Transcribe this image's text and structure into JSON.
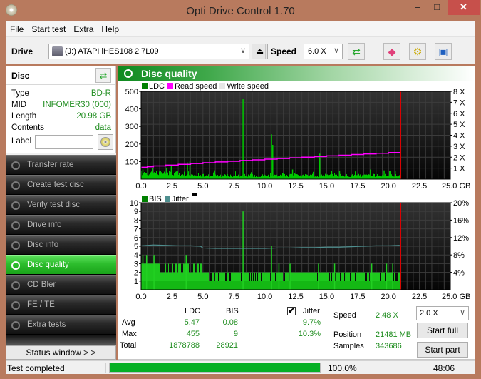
{
  "window": {
    "title": "Opti Drive Control 1.70",
    "min_glyph": "–",
    "max_glyph": "□",
    "close_glyph": "✕"
  },
  "menu": [
    "File",
    "Start test",
    "Extra",
    "Help"
  ],
  "toolbar": {
    "drive_label": "Drive",
    "drive_value": "(J:)   ATAPI iHES108   2 7L09",
    "speed_label": "Speed",
    "speed_value": "6.0 X",
    "eject_glyph": "⏏",
    "refresh_glyph": "⇄",
    "erase_glyph": "◆",
    "settings_glyph": "⚙",
    "save_glyph": "▣",
    "chevron": "∨"
  },
  "disc": {
    "title": "Disc",
    "refresh_glyph": "⇄",
    "rows": [
      {
        "key": "Type",
        "value": "BD-R"
      },
      {
        "key": "MID",
        "value": "INFOMER30 (000)"
      },
      {
        "key": "Length",
        "value": "20.98 GB"
      },
      {
        "key": "Contents",
        "value": "data"
      }
    ],
    "label_key": "Label",
    "label_value": ""
  },
  "nav": [
    {
      "label": "Transfer rate",
      "active": false
    },
    {
      "label": "Create test disc",
      "active": false
    },
    {
      "label": "Verify test disc",
      "active": false
    },
    {
      "label": "Drive info",
      "active": false
    },
    {
      "label": "Disc info",
      "active": false
    },
    {
      "label": "Disc quality",
      "active": true
    },
    {
      "label": "CD Bler",
      "active": false
    },
    {
      "label": "FE / TE",
      "active": false
    },
    {
      "label": "Extra tests",
      "active": false
    }
  ],
  "status_window_button": "Status window > >",
  "panel_title": "Disc quality",
  "colors": {
    "ldc": "#00c800",
    "read_speed": "#ff00ff",
    "write_speed": "#e6e6e6",
    "bis": "#008000",
    "jitter": "#4f8f8f",
    "end_marker": "#e00000",
    "accent": "#1fa81f"
  },
  "chart_data": [
    {
      "type": "bar",
      "title": "LDC / Read speed",
      "legend": [
        "LDC",
        "Read speed",
        "Write speed"
      ],
      "legend_placement": "top-left",
      "xlabel": "GB",
      "x_ticks": [
        "0.0",
        "2.5",
        "5.0",
        "7.5",
        "10.0",
        "12.5",
        "15.0",
        "17.5",
        "20.0",
        "22.5",
        "25.0 GB"
      ],
      "xlim": [
        0,
        25
      ],
      "ylim": [
        0,
        500
      ],
      "y_ticks": [
        "500",
        "400",
        "300",
        "200",
        "100"
      ],
      "y2lim": [
        0,
        8
      ],
      "y2_ticks": [
        "8 X",
        "7 X",
        "6 X",
        "5 X",
        "4 X",
        "3 X",
        "2 X",
        "1 X"
      ],
      "grid": true,
      "end_marker_gb": 20.98,
      "ldc_baseline": 20,
      "ldc_spikes": [
        {
          "x": 0.1,
          "y": 55
        },
        {
          "x": 0.5,
          "y": 65
        },
        {
          "x": 2.4,
          "y": 80
        },
        {
          "x": 3.7,
          "y": 95
        },
        {
          "x": 3.9,
          "y": 100
        },
        {
          "x": 8.2,
          "y": 455
        },
        {
          "x": 10.5,
          "y": 255
        },
        {
          "x": 10.6,
          "y": 195
        },
        {
          "x": 14.4,
          "y": 145
        },
        {
          "x": 12.2,
          "y": 55
        },
        {
          "x": 16.0,
          "y": 45
        },
        {
          "x": 18.5,
          "y": 55
        },
        {
          "x": 19.6,
          "y": 50
        },
        {
          "x": 20.5,
          "y": 45
        }
      ],
      "read_speed_x": [
        0,
        0.5,
        1,
        2,
        3,
        4,
        5,
        6,
        7,
        8,
        9,
        10,
        11,
        12,
        13,
        14,
        15,
        16,
        17,
        18,
        19,
        20,
        20.98
      ],
      "read_speed_y": [
        1.08,
        1.13,
        1.2,
        1.28,
        1.35,
        1.42,
        1.5,
        1.57,
        1.63,
        1.7,
        1.76,
        1.82,
        1.88,
        1.94,
        2.0,
        2.06,
        2.12,
        2.18,
        2.24,
        2.3,
        2.36,
        2.42,
        2.48
      ]
    },
    {
      "type": "bar",
      "title": "BIS / Jitter",
      "legend": [
        "BIS",
        "Jitter"
      ],
      "legend_placement": "top-left",
      "xlabel": "GB",
      "x_ticks": [
        "0.0",
        "2.5",
        "5.0",
        "7.5",
        "10.0",
        "12.5",
        "15.0",
        "17.5",
        "20.0",
        "22.5",
        "25.0 GB"
      ],
      "xlim": [
        0,
        25
      ],
      "ylim": [
        0,
        10
      ],
      "y_ticks": [
        "10",
        "9",
        "8",
        "7",
        "6",
        "5",
        "4",
        "3",
        "2",
        "1"
      ],
      "y2lim": [
        0,
        20
      ],
      "y2_ticks": [
        "20%",
        "16%",
        "12%",
        "8%",
        "4%"
      ],
      "grid": true,
      "end_marker_gb": 20.98,
      "bis_spikes": [
        {
          "x": 0.1,
          "y": 4
        },
        {
          "x": 0.4,
          "y": 4
        },
        {
          "x": 1.0,
          "y": 4
        },
        {
          "x": 3.6,
          "y": 4
        },
        {
          "x": 8.2,
          "y": 9
        },
        {
          "x": 10.5,
          "y": 5
        },
        {
          "x": 11.1,
          "y": 3
        },
        {
          "x": 12.0,
          "y": 3
        },
        {
          "x": 14.3,
          "y": 3
        },
        {
          "x": 15.6,
          "y": 3
        },
        {
          "x": 18.6,
          "y": 3
        },
        {
          "x": 19.8,
          "y": 3
        },
        {
          "x": 20.3,
          "y": 3
        }
      ],
      "jitter_x": [
        0,
        1,
        2,
        3,
        4,
        4.8,
        5.0,
        6,
        7,
        8,
        9,
        10,
        11,
        12,
        13,
        14,
        15,
        16,
        17,
        18,
        19,
        20,
        20.9
      ],
      "jitter_y": [
        10.1,
        10.3,
        10.2,
        10.1,
        10.1,
        10.0,
        9.6,
        9.5,
        9.5,
        9.5,
        9.5,
        9.5,
        9.6,
        9.6,
        9.7,
        9.7,
        9.8,
        9.8,
        9.9,
        10.0,
        10.1,
        10.1,
        10.2
      ]
    }
  ],
  "stats": {
    "col_ldc": "LDC",
    "col_bis": "BIS",
    "col_jitter": "Jitter",
    "jitter_checked": true,
    "check_glyph": "✔",
    "rows": [
      {
        "label": "Avg",
        "ldc": "5.47",
        "bis": "0.08",
        "jitter": "9.7%"
      },
      {
        "label": "Max",
        "ldc": "455",
        "bis": "9",
        "jitter": "10.3%"
      },
      {
        "label": "Total",
        "ldc": "1878788",
        "bis": "28921",
        "jitter": ""
      }
    ],
    "speed_label": "Speed",
    "speed_value": "2.48 X",
    "position_label": "Position",
    "position_value": "21481 MB",
    "samples_label": "Samples",
    "samples_value": "343686",
    "test_speed_value": "2.0 X",
    "start_full": "Start full",
    "start_part": "Start part"
  },
  "statusbar": {
    "message": "Test completed",
    "progress_percent": 100,
    "progress_text": "100.0%",
    "elapsed": "48:06"
  }
}
